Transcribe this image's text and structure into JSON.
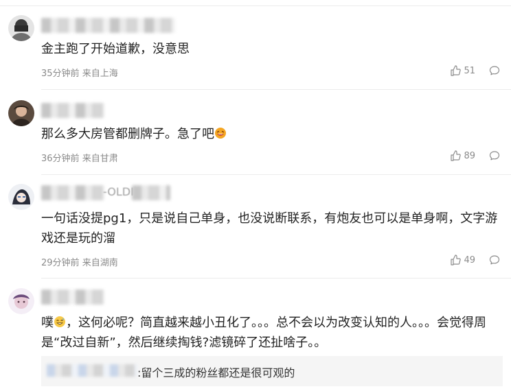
{
  "comments": [
    {
      "text": "金主跑了开始道歉，没意思",
      "time": "35分钟前",
      "location": "来自上海",
      "likes": "51"
    },
    {
      "text": "那么多大房管都删牌子。急了吧",
      "emoji": "laughing-face",
      "time": "36分钟前",
      "location": "来自甘肃",
      "likes": "89"
    },
    {
      "username_partial": "-OLDI",
      "text": "一句话没提pg1，只是说自己单身，也没说断联系，有炮友也可以是单身啊，文字游戏还是玩的溜",
      "time": "29分钟前",
      "location": "来自湖南",
      "likes": "49"
    },
    {
      "text_before_emoji": "噗",
      "emoji": "grin-sweat-face",
      "text": "，这何必呢？简直越来越小丑化了。。。总不会以为改变认知的人。。。会觉得周是“改过自新”，然后继续掏钱?滤镜碎了还扯啥子。。",
      "reply": {
        "text": ":留个三成的粉丝都还是很可观的"
      }
    }
  ],
  "colors": {
    "text": "#222222",
    "meta": "#8a8a8a",
    "divider": "#ececec",
    "reply_bg": "#f5f5f5"
  }
}
